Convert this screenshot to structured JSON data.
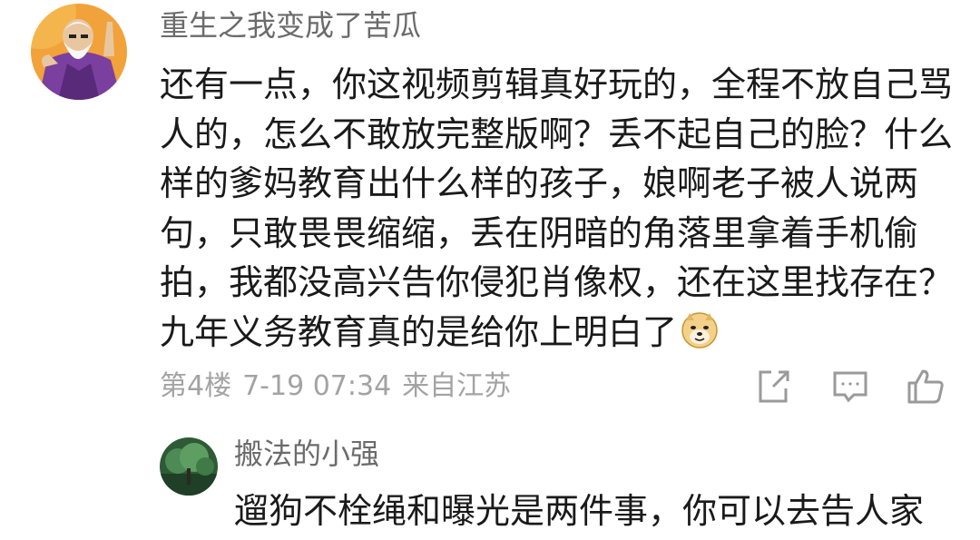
{
  "comment": {
    "username": "重生之我变成了苦瓜",
    "lines": [
      "还有一点，你这视频剪辑真好玩的，全程不放自己骂",
      "人的，怎么不敢放完整版啊？丢不起自己的脸？什么",
      "样的爹妈教育出什么样的孩子，娘啊老子被人说两",
      "句，只敢畏畏缩缩，丢在阴暗的角落里拿着手机偷",
      "拍，我都没高兴告你侵犯肖像权，还在这里找存在？",
      "九年义务教育真的是给你上明白了"
    ],
    "emoji": "doge-emoji",
    "floor": "第4楼",
    "time": "7-19 07:34",
    "location": "来自江苏",
    "actions": [
      "share-icon",
      "comment-icon",
      "like-icon"
    ]
  },
  "reply": {
    "username": "搬法的小强",
    "text": "遛狗不栓绳和曝光是两件事，你可以去告人家"
  }
}
